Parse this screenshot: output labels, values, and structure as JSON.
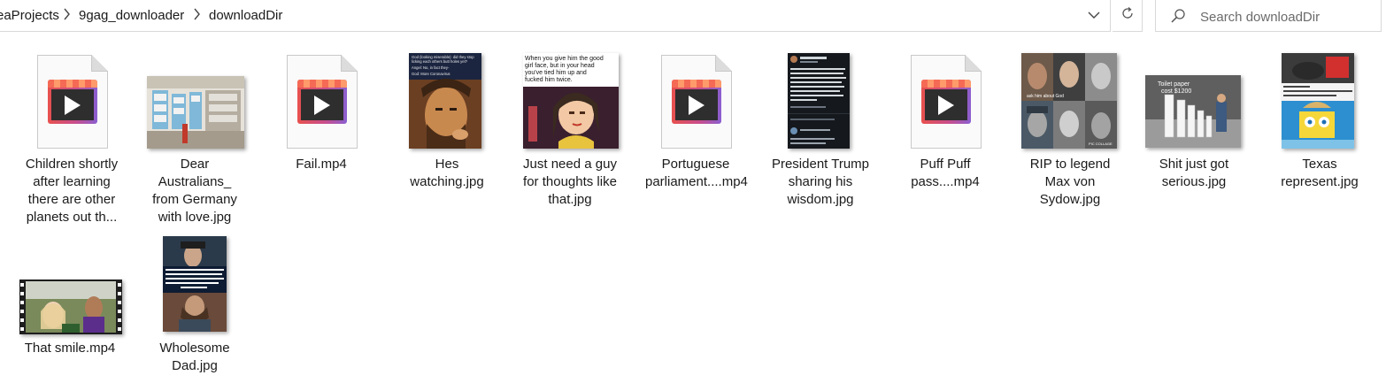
{
  "address": {
    "breadcrumbs": [
      "eaProjects",
      "9gag_downloader",
      "downloadDir"
    ]
  },
  "search": {
    "placeholder": "Search downloadDir"
  },
  "items": [
    {
      "label": "Children shortly\nafter learning\nthere are other\nplanets out th...",
      "type": "video"
    },
    {
      "label": "Dear Australians_\nfrom Germany\nwith love.jpg",
      "type": "image"
    },
    {
      "label": "Fail.mp4",
      "type": "video"
    },
    {
      "label": "Hes watching.jpg",
      "type": "image"
    },
    {
      "label": "Just need a guy\nfor thoughts like\nthat.jpg",
      "type": "image"
    },
    {
      "label": "Portuguese\nparliament....mp4",
      "type": "video"
    },
    {
      "label": "President Trump\nsharing his\nwisdom.jpg",
      "type": "image"
    },
    {
      "label": "Puff Puff\npass....mp4",
      "type": "video"
    },
    {
      "label": "RIP to legend\nMax von\nSydow.jpg",
      "type": "image"
    },
    {
      "label": "Shit just got\nserious.jpg",
      "type": "image"
    },
    {
      "label": "Texas\nrepresent.jpg",
      "type": "image"
    },
    {
      "label": "That smile.mp4",
      "type": "video"
    },
    {
      "label": "Wholesome\nDad.jpg",
      "type": "image"
    }
  ],
  "thumb_text": {
    "hes_watching": "God (looking miserable): did they stop licking each others butt holes yet?\nAngel: No, in fact they-\nGod: More Coronavirus",
    "just_need": "When you give him the good girl face, but in your head you've tied him up and fucked him twice.",
    "rip": "ask him about God",
    "rip_footer": "PIC COLLAGE",
    "shit": "Toilet paper\ncost $1200"
  },
  "colors": {
    "accent_text": "#1a1a1a",
    "border": "#d9d9d9"
  }
}
